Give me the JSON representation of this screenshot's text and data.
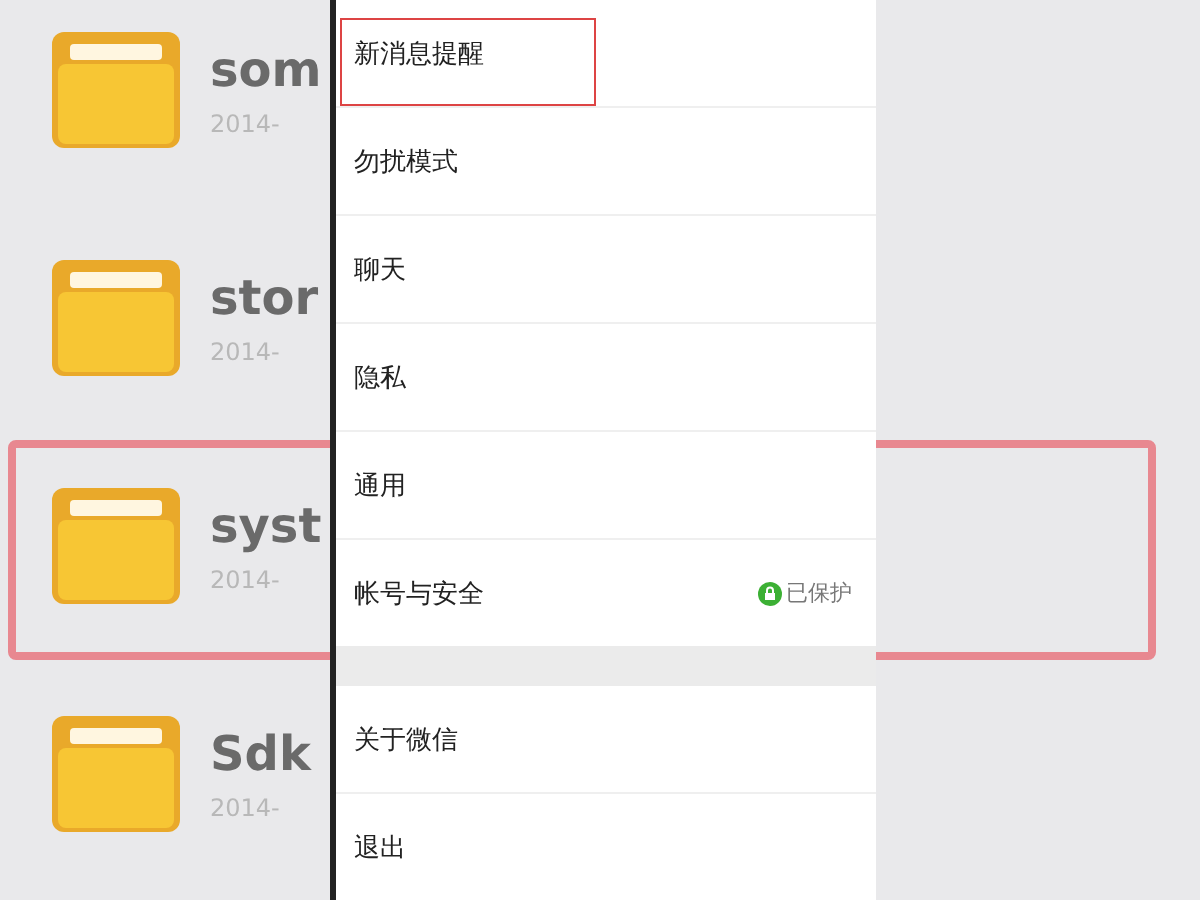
{
  "background": {
    "folders": [
      {
        "name": "som",
        "date": "2014-",
        "highlighted": false
      },
      {
        "name": "stor",
        "date": "2014-",
        "highlighted": false
      },
      {
        "name": "syst",
        "date": "2014-",
        "highlighted": true
      },
      {
        "name": "Sdk",
        "date": "2014-",
        "highlighted": false
      }
    ]
  },
  "settings": {
    "groups": [
      {
        "items": [
          {
            "label": "新消息提醒",
            "highlighted": true
          },
          {
            "label": "勿扰模式",
            "highlighted": false
          },
          {
            "label": "聊天",
            "highlighted": false
          },
          {
            "label": "隐私",
            "highlighted": false
          },
          {
            "label": "通用",
            "highlighted": false
          },
          {
            "label": "帐号与安全",
            "highlighted": false,
            "value": "已保护"
          }
        ]
      },
      {
        "items": [
          {
            "label": "关于微信",
            "highlighted": false
          },
          {
            "label": "退出",
            "highlighted": false
          }
        ]
      }
    ]
  }
}
